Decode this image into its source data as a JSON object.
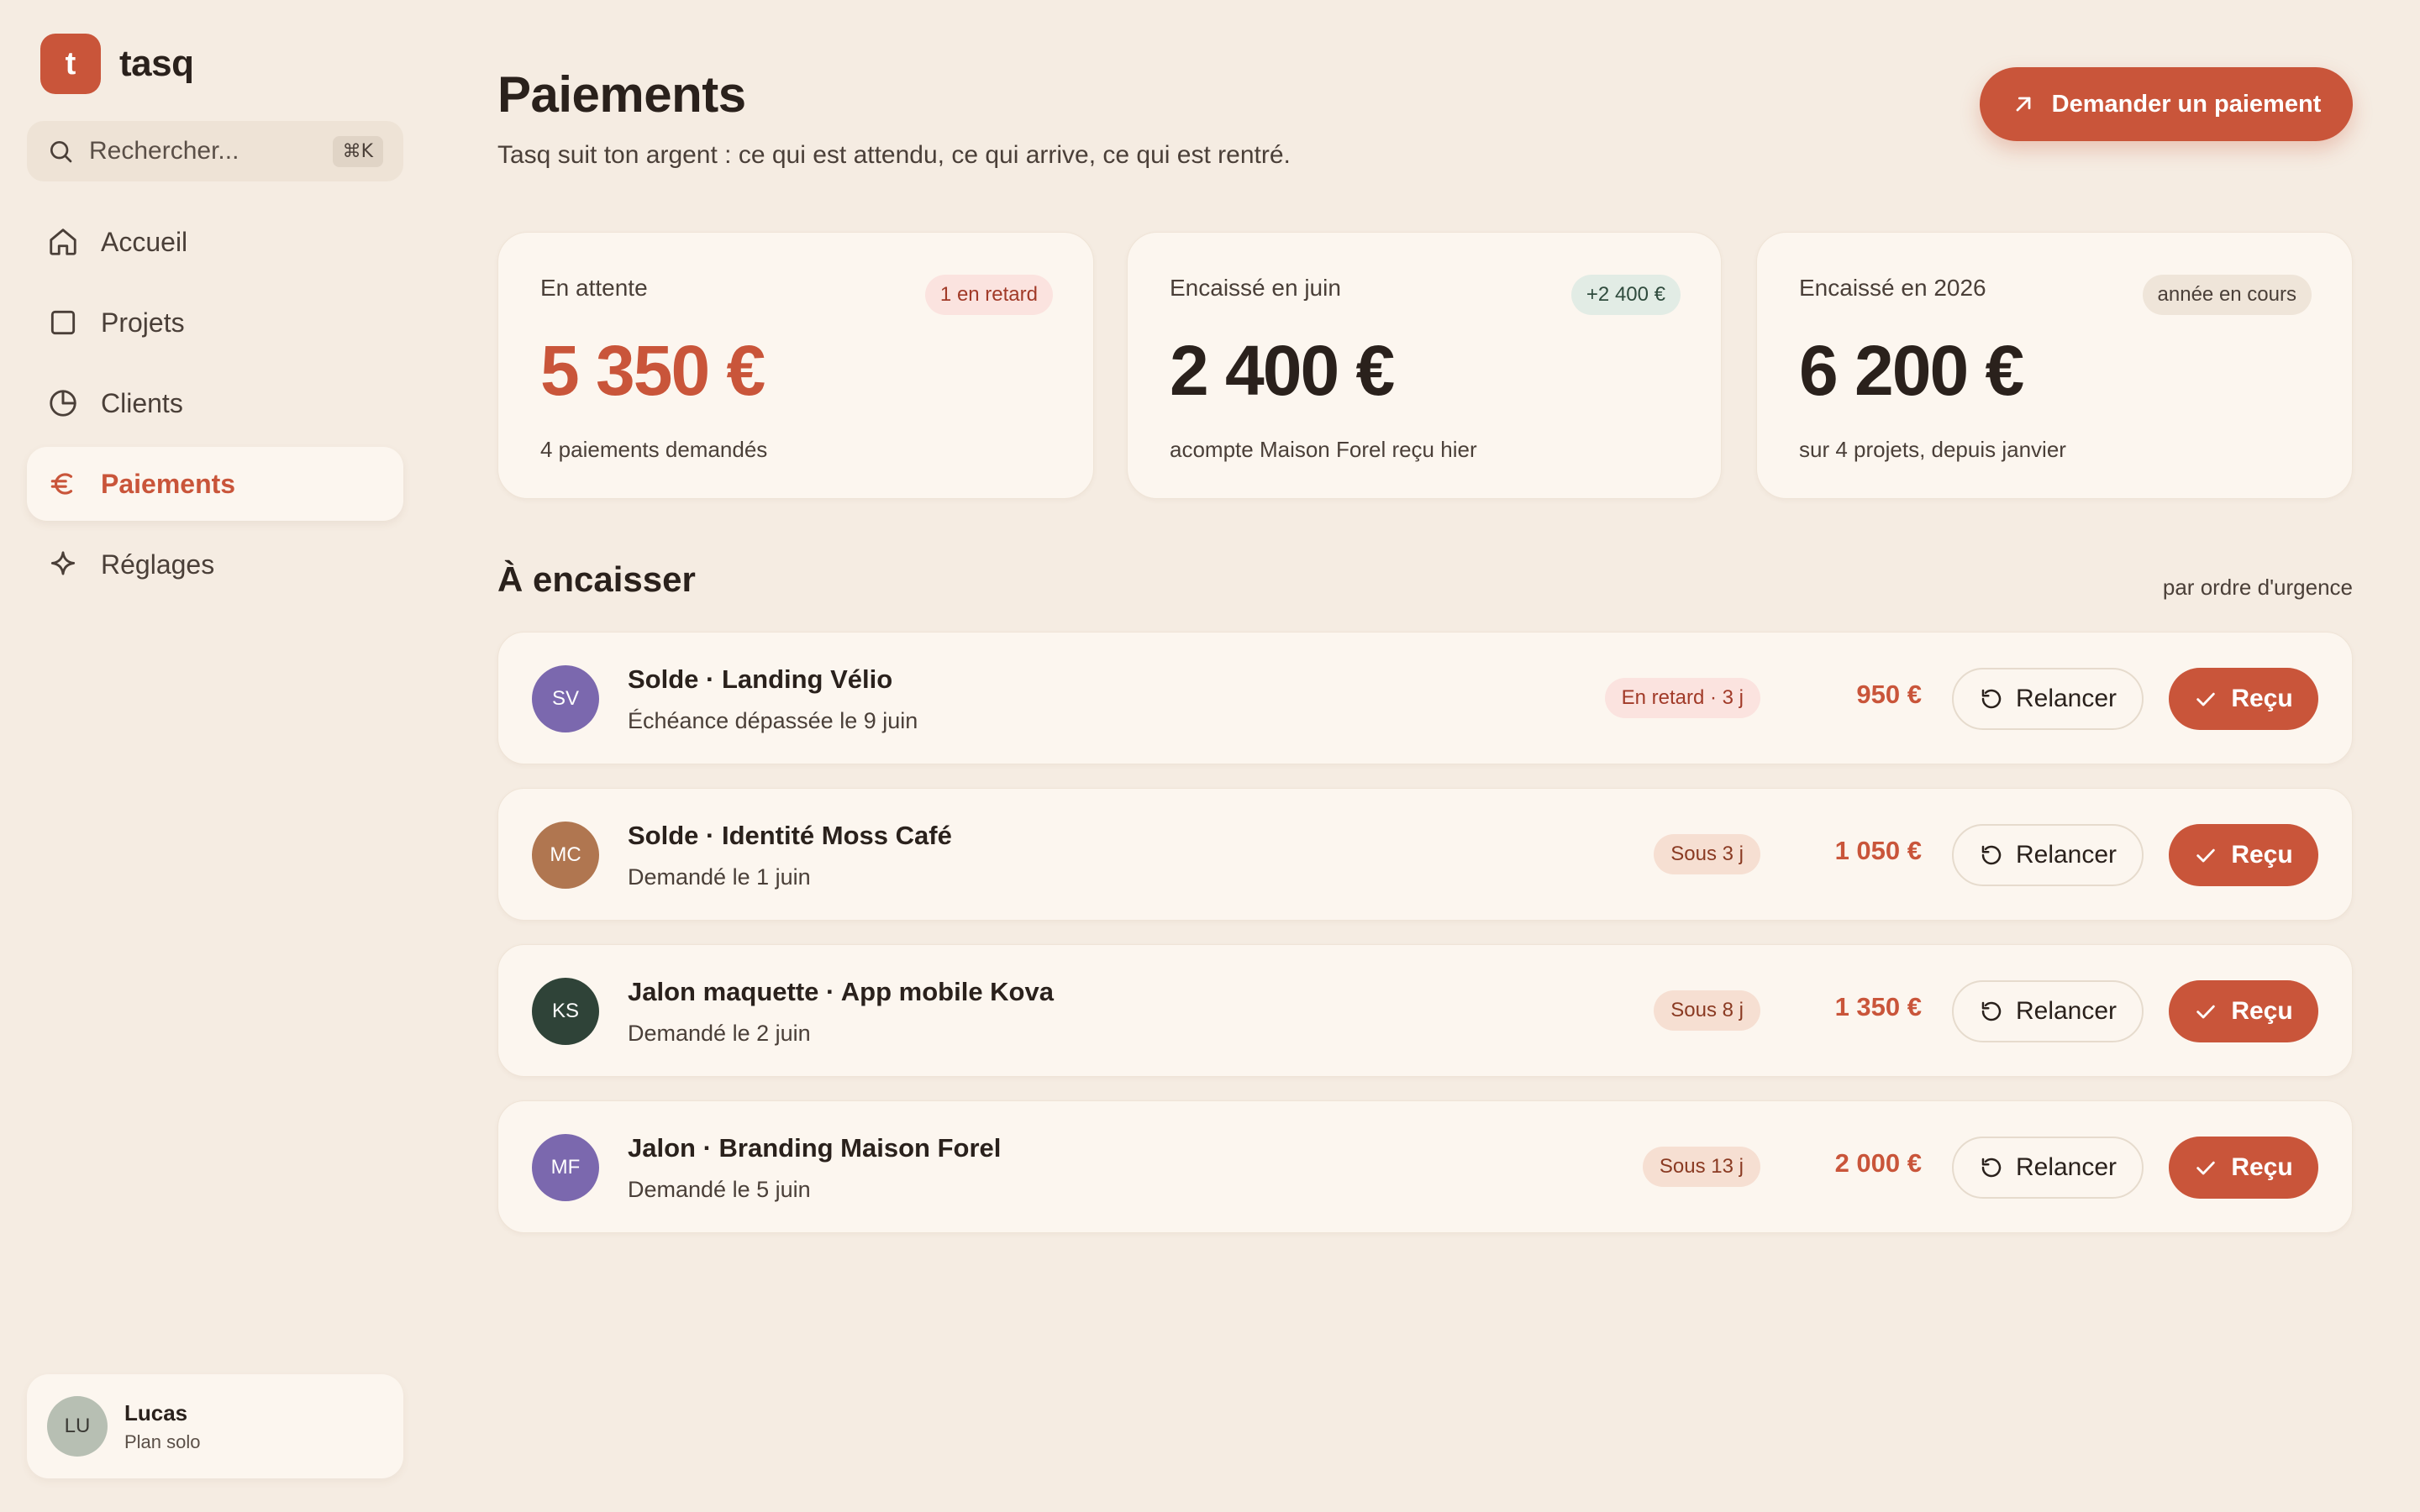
{
  "brand": {
    "initial": "t",
    "name": "tasq",
    "color": "#c9553a"
  },
  "search": {
    "placeholder": "Rechercher...",
    "shortcut": "⌘K"
  },
  "sidebar": {
    "items": [
      {
        "label": "Accueil",
        "icon": "home-icon",
        "active": false
      },
      {
        "label": "Projets",
        "icon": "square-icon",
        "active": false
      },
      {
        "label": "Clients",
        "icon": "pie-chart-icon",
        "active": false
      },
      {
        "label": "Paiements",
        "icon": "euro-icon",
        "active": true
      },
      {
        "label": "Réglages",
        "icon": "sparkle-icon",
        "active": false
      }
    ]
  },
  "user": {
    "initials": "LU",
    "name": "Lucas",
    "plan": "Plan solo"
  },
  "header": {
    "title": "Paiements",
    "subtitle": "Tasq suit ton argent : ce qui est attendu, ce qui arrive, ce qui est rentré.",
    "primary_action": "Demander un paiement"
  },
  "stats": [
    {
      "label": "En attente",
      "badge": "1 en retard",
      "value": "5 350 €",
      "sub": "4 paiements demandés"
    },
    {
      "label": "Encaissé en juin",
      "badge": "+2 400 €",
      "value": "2 400 €",
      "sub": "acompte Maison Forel reçu hier"
    },
    {
      "label": "Encaissé en 2026",
      "badge": "année en cours",
      "value": "6 200 €",
      "sub": "sur 4 projets, depuis janvier"
    }
  ],
  "section": {
    "title": "À encaisser",
    "hint": "par ordre d'urgence"
  },
  "actions": {
    "remind": "Relancer",
    "received": "Reçu"
  },
  "payments": [
    {
      "initials": "SV",
      "avatar_color": "#7b68ae",
      "title": "Solde · Landing Vélio",
      "sub": "Échéance dépassée le 9 juin",
      "tag": "En retard · 3 j",
      "amount": "950 €"
    },
    {
      "initials": "MC",
      "avatar_color": "#b07650",
      "title": "Solde · Identité Moss Café",
      "sub": "Demandé le 1 juin",
      "tag": "Sous 3 j",
      "amount": "1 050 €"
    },
    {
      "initials": "KS",
      "avatar_color": "#2f4338",
      "title": "Jalon maquette · App mobile Kova",
      "sub": "Demandé le 2 juin",
      "tag": "Sous 8 j",
      "amount": "1 350 €"
    },
    {
      "initials": "MF",
      "avatar_color": "#7b68ae",
      "title": "Jalon · Branding Maison Forel",
      "sub": "Demandé le 5 juin",
      "tag": "Sous 13 j",
      "amount": "2 000 €"
    }
  ]
}
